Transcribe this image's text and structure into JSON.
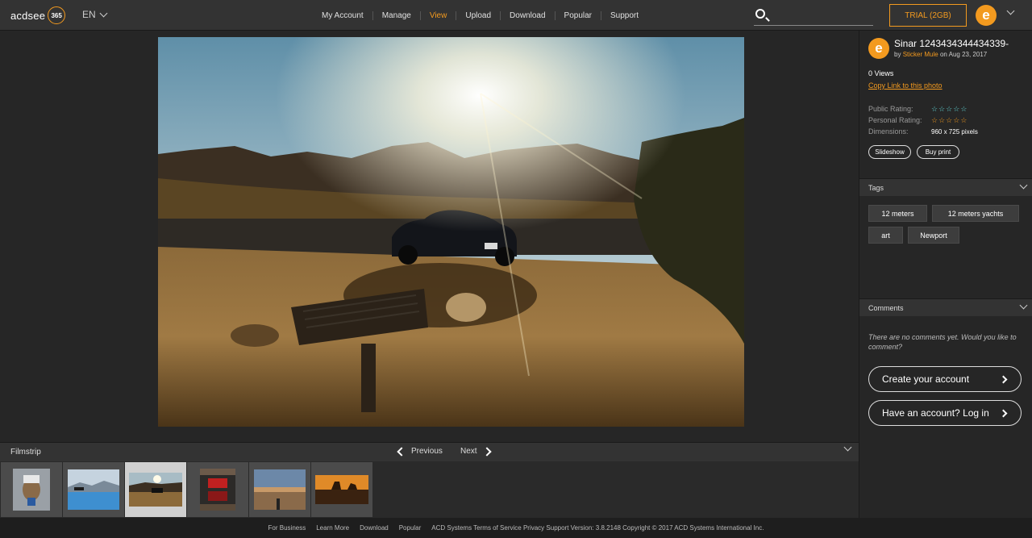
{
  "header": {
    "logo_text": "acdsee",
    "logo_badge": "365",
    "language": "EN",
    "nav": [
      {
        "label": "My Account",
        "active": false
      },
      {
        "label": "Manage",
        "active": false
      },
      {
        "label": "View",
        "active": true
      },
      {
        "label": "Upload",
        "active": false
      },
      {
        "label": "Download",
        "active": false
      },
      {
        "label": "Popular",
        "active": false
      },
      {
        "label": "Support",
        "active": false
      }
    ],
    "search_value": "",
    "trial_label": "TRIAL (2GB)",
    "avatar_letter": "e",
    "accent_color": "#f39a1f"
  },
  "photo": {
    "title": "Sinar 1243434344434339-",
    "by_prefix": "by",
    "author": "Sticker Mule",
    "date_prefix": "on",
    "date": "Aug 23, 2017",
    "views": "0 Views",
    "copy_link": "Copy Link to this photo",
    "public_rating_label": "Public Rating:",
    "personal_rating_label": "Personal Rating:",
    "dimensions_label": "Dimensions:",
    "dimensions_value": "960 x 725 pixels",
    "public_stars": [
      "☆",
      "☆",
      "☆",
      "☆",
      "☆"
    ],
    "personal_stars": [
      "☆",
      "☆",
      "☆",
      "☆",
      "☆"
    ],
    "slideshow_label": "Slideshow",
    "buy_print_label": "Buy print"
  },
  "tags": {
    "heading": "Tags",
    "items": [
      "12 meters",
      "12 meters yachts",
      "art",
      "Newport"
    ]
  },
  "comments": {
    "heading": "Comments",
    "empty_text": "There are no comments yet. Would you like to comment?",
    "create_account": "Create your account",
    "login": "Have an account? Log in"
  },
  "filmstrip": {
    "label": "Filmstrip",
    "previous": "Previous",
    "next": "Next",
    "thumbs": [
      {
        "name": "dog-in-hat"
      },
      {
        "name": "lake-kayak"
      },
      {
        "name": "desert-car",
        "selected": true
      },
      {
        "name": "red-car-reflection"
      },
      {
        "name": "city-sunset"
      },
      {
        "name": "sunset-landscape"
      }
    ]
  },
  "footer": {
    "items": [
      "For Business",
      "Learn More",
      "Download",
      "Popular",
      "ACD Systems Terms of Service Privacy Support Version: 3.8.2148 Copyright © 2017 ACD Systems International Inc."
    ]
  }
}
